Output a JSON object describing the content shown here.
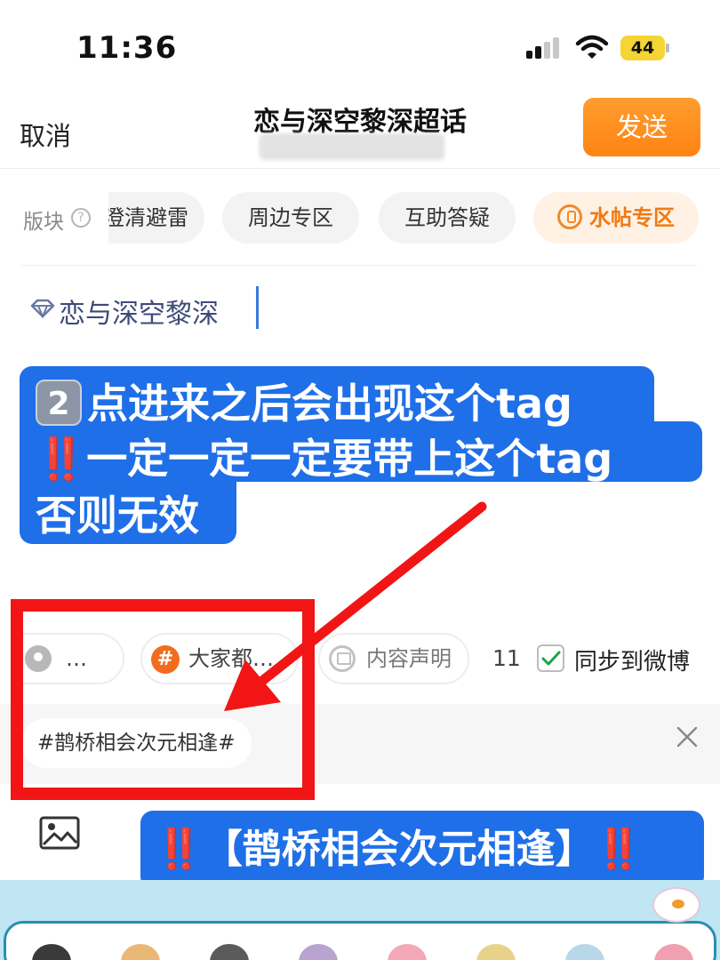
{
  "status_bar": {
    "time": "11:36",
    "battery": "44"
  },
  "nav": {
    "cancel_label": "取消",
    "title": "恋与深空黎深超话",
    "send_label": "发送"
  },
  "category": {
    "label": "版块",
    "chips": [
      {
        "label": "澄清避雷",
        "active": false
      },
      {
        "label": "周边专区",
        "active": false
      },
      {
        "label": "互助答疑",
        "active": false
      },
      {
        "label": "水帖专区",
        "active": true
      }
    ]
  },
  "topic": {
    "text": "恋与深空黎深"
  },
  "annotation": {
    "line1_emoji": "2",
    "line1": "点进来之后会出现这个tag",
    "line2_bangs": "‼️",
    "line2": "一定一定一定要带上这个tag",
    "line3": "否则无效"
  },
  "toolbar": {
    "location_label": "…",
    "hashtag_label": "大家都…",
    "declaration_label": "内容声明",
    "count": "11",
    "sync_checked": true,
    "sync_label": "同步到微博"
  },
  "suggestion": {
    "tag": "#鹊桥相会次元相逢#"
  },
  "annotation2": {
    "bangs_left": "‼️",
    "text": "【鹊桥相会次元相逢】",
    "bangs_right": "‼️"
  },
  "colors": {
    "accent_orange": "#ff8a1c",
    "annotation_blue": "#1f6fe8",
    "highlight_red": "#f21515"
  },
  "icons": [
    "help-icon",
    "diamond-icon",
    "location-icon",
    "hashtag-icon",
    "declaration-icon",
    "checkbox-icon",
    "close-icon",
    "image-icon"
  ]
}
